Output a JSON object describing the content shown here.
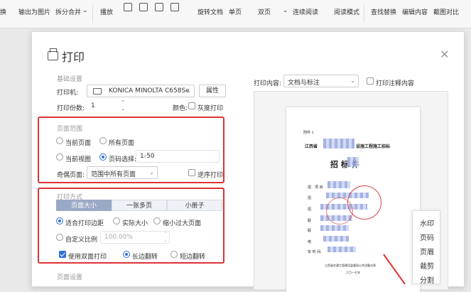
{
  "toolbar": {
    "items": [
      "换",
      "输出为图片",
      "拆分合并",
      "播放",
      "旋转文档",
      "单页",
      "双页",
      "连续阅读",
      "阅读模式",
      "查找替换",
      "编辑内容",
      "截图对比"
    ]
  },
  "dialog": {
    "title": "打印",
    "basic": {
      "section": "基础设置",
      "printer_label": "打印机:",
      "printer_value": "KONICA MINOLTA C658Se",
      "properties_btn": "属性",
      "copies_label": "打印份数:",
      "copies_value": "1",
      "color_label": "颜色:",
      "grayscale_label": "灰度打印"
    },
    "range": {
      "section": "页面范围",
      "current_page": "当前页面",
      "all_pages": "所有页面",
      "current_view": "当前视图",
      "page_select": "页码选择:",
      "page_value": "1-50",
      "odd_even_label": "奇偶页面:",
      "odd_even_value": "范围中所有页面",
      "reverse_label": "逆序打印"
    },
    "mode": {
      "section": "打印方式",
      "tabs": [
        "页面大小",
        "一张多页",
        "小册子"
      ],
      "fit_margin": "适合打印边距",
      "actual_size": "实际大小",
      "shrink_large": "缩小过大页面",
      "custom_scale": "自定义比例",
      "scale_value": "100.00%",
      "duplex_label": "使用双面打印",
      "long_edge": "长边翻转",
      "short_edge": "短边翻转"
    },
    "page_settings": {
      "section": "页面设置"
    },
    "preview": {
      "content_label": "打印内容:",
      "content_value": "文档与标注",
      "print_comments": "打印注释内容",
      "doc": {
        "top_left": "附件 1",
        "line1": "江西省",
        "line1b": "设施工程施工招标",
        "title": "招    标    件",
        "rows": [
          "招",
          "项 目",
          "招",
          "招",
          "联",
          "联",
          "电",
          "实 时 间:"
        ],
        "sign1": "江西省交通工程建设监督局公共设备交易",
        "sign2": "二〇一七年"
      }
    }
  },
  "side_menu": [
    "水印",
    "页码",
    "页眉",
    "裁剪",
    "分割"
  ]
}
